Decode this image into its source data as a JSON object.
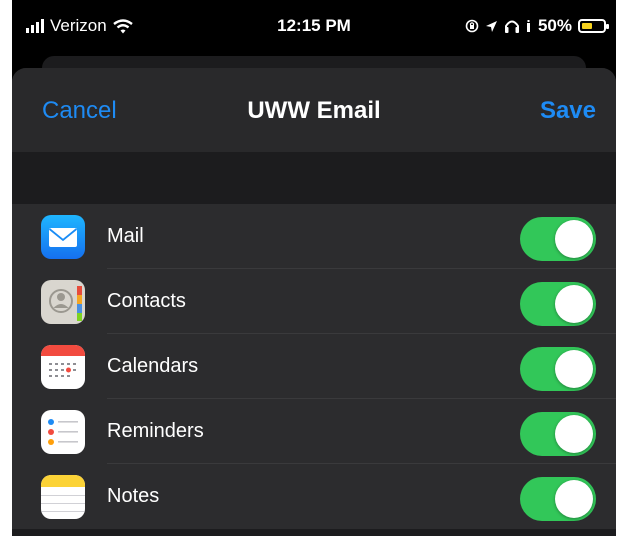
{
  "status_bar": {
    "carrier": "Verizon",
    "time": "12:15 PM",
    "battery": "50%",
    "battery_level": 0.5,
    "icons": [
      "signal-icon",
      "wifi-icon",
      "lock-rotation-icon",
      "location-icon",
      "headphones-icon",
      "battery-icon"
    ]
  },
  "nav": {
    "cancel_label": "Cancel",
    "title": "UWW Email",
    "save_label": "Save"
  },
  "colors": {
    "accent": "#1e8bf4",
    "toggle_on": "#32c759",
    "battery_low_power": "#f6d21f"
  },
  "services": [
    {
      "label": "Mail",
      "icon": "mail-icon",
      "enabled": true
    },
    {
      "label": "Contacts",
      "icon": "contacts-icon",
      "enabled": true
    },
    {
      "label": "Calendars",
      "icon": "calendar-icon",
      "enabled": true
    },
    {
      "label": "Reminders",
      "icon": "reminders-icon",
      "enabled": true
    },
    {
      "label": "Notes",
      "icon": "notes-icon",
      "enabled": true
    }
  ]
}
